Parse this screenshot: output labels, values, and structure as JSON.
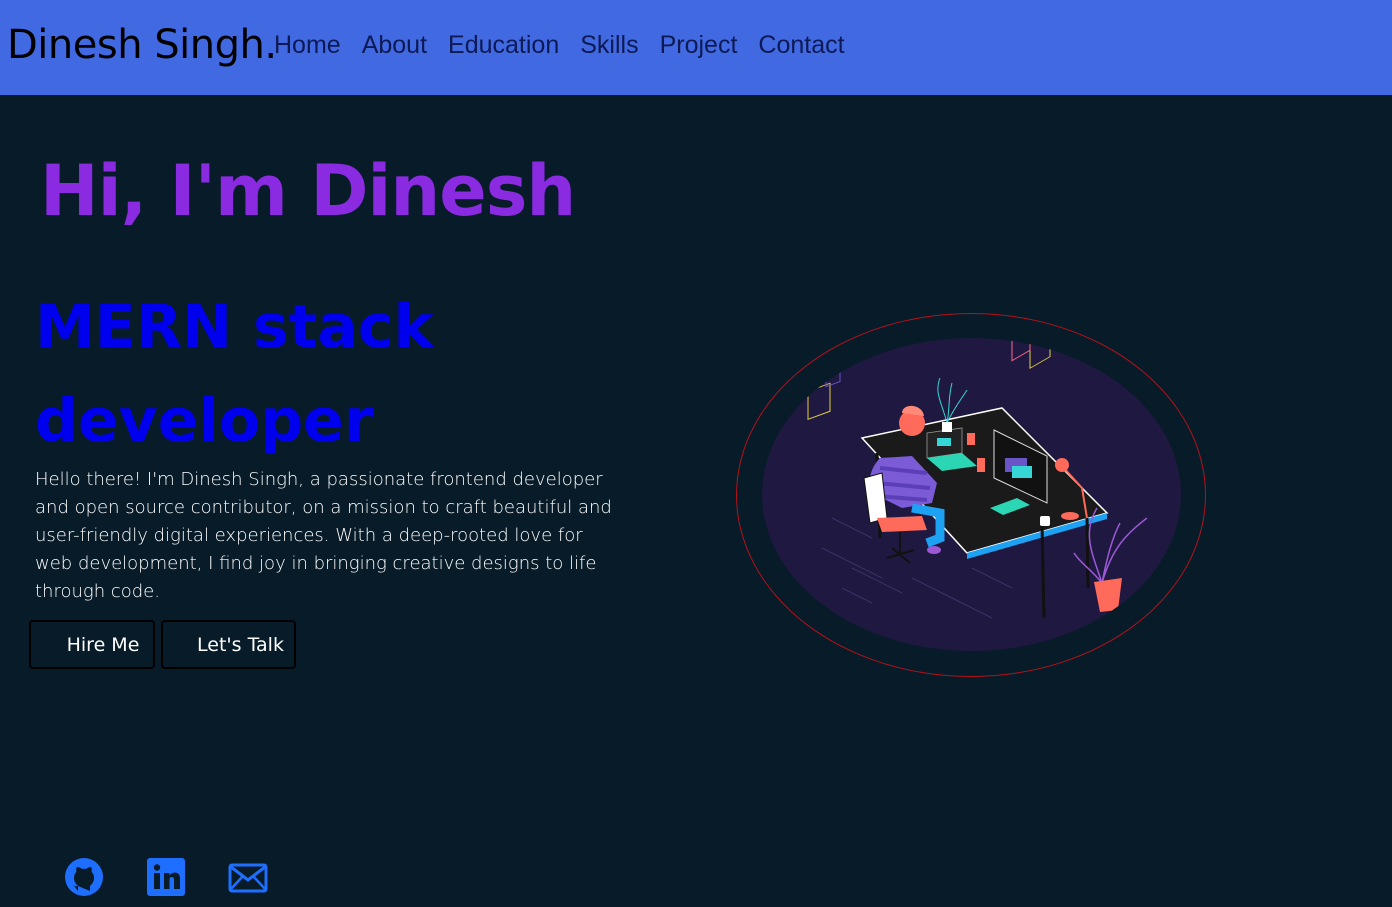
{
  "header": {
    "brand": "Dinesh Singh.",
    "nav": [
      "Home",
      "About",
      "Education",
      "Skills",
      "Project",
      "Contact"
    ]
  },
  "hero": {
    "greeting": "Hi, I'm Dinesh",
    "role": "MERN stack developer",
    "intro": "Hello there! I'm Dinesh Singh, a passionate frontend developer and open source contributor, on a mission to craft beautiful and user-friendly digital experiences. With a deep-rooted love for web development, I find joy in bringing creative designs to life through code.",
    "buttons": {
      "hire": "Hire Me",
      "talk": "Let's Talk"
    },
    "illustration": "developer-at-desk-illustration"
  },
  "social": [
    "github-icon",
    "linkedin-icon",
    "mail-icon"
  ],
  "colors": {
    "navbar": "#4169e1",
    "background": "#081b29",
    "greeting": "#8a2be2",
    "role": "#0000ee",
    "icons": "#1e6fff"
  }
}
